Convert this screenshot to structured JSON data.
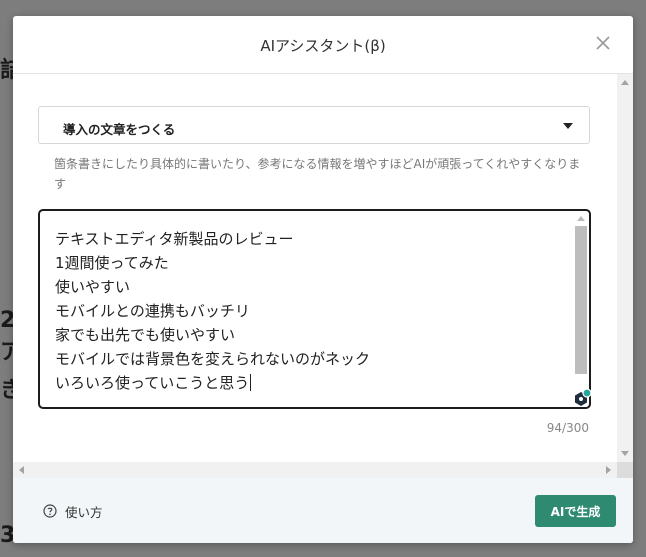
{
  "background": {
    "fragments": [
      "詰",
      "2",
      "ア",
      "き",
      "3"
    ]
  },
  "modal": {
    "title": "AIアシスタント(β)",
    "close_icon": "close-icon",
    "select": {
      "value": "導入の文章をつくる",
      "caret_icon": "caret-down-icon"
    },
    "hint": "箇条書きにしたり具体的に書いたり、参考になる情報を増やすほどAIが頑張ってくれやすくなります",
    "textarea": {
      "lines": [
        "テキストエディタ新製品のレビュー",
        "1週間使ってみた",
        "使いやすい",
        "モバイルとの連携もバッチリ",
        "家でも出先でも使いやすい",
        "モバイルでは背景色を変えられないのがネック",
        "いろいろ使っていこうと思う"
      ],
      "badge_icon": "grammarly-badge-icon",
      "badge_color": "#26a69a"
    },
    "counter": "94/300",
    "footer": {
      "help_icon": "question-circle-icon",
      "help_label": "使い方",
      "generate_label": "AIで生成",
      "accent": "#2e8b72"
    }
  }
}
